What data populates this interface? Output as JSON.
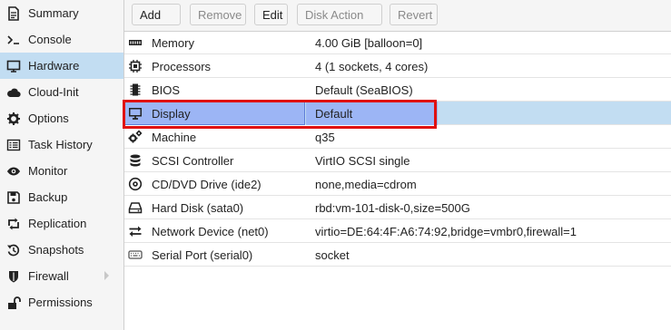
{
  "sidebar": {
    "items": [
      {
        "label": "Summary",
        "icon": "summary-icon"
      },
      {
        "label": "Console",
        "icon": "console-icon"
      },
      {
        "label": "Hardware",
        "icon": "monitor-icon",
        "selected": true
      },
      {
        "label": "Cloud-Init",
        "icon": "cloud-icon"
      },
      {
        "label": "Options",
        "icon": "gear-icon"
      },
      {
        "label": "Task History",
        "icon": "list-icon"
      },
      {
        "label": "Monitor",
        "icon": "eye-icon"
      },
      {
        "label": "Backup",
        "icon": "floppy-icon"
      },
      {
        "label": "Replication",
        "icon": "retweet-icon"
      },
      {
        "label": "Snapshots",
        "icon": "history-icon"
      },
      {
        "label": "Firewall",
        "icon": "shield-icon",
        "has_submenu": true
      },
      {
        "label": "Permissions",
        "icon": "unlock-icon"
      }
    ]
  },
  "toolbar": {
    "add_label": "Add",
    "remove_label": "Remove",
    "edit_label": "Edit",
    "disk_action_label": "Disk Action",
    "revert_label": "Revert"
  },
  "hardware": {
    "rows": [
      {
        "name": "Memory",
        "value": "4.00 GiB [balloon=0]",
        "icon": "memory-icon"
      },
      {
        "name": "Processors",
        "value": "4 (1 sockets, 4 cores)",
        "icon": "cpu-icon"
      },
      {
        "name": "BIOS",
        "value": "Default (SeaBIOS)",
        "icon": "microchip-icon"
      },
      {
        "name": "Display",
        "value": "Default",
        "icon": "desktop-icon",
        "selected": true
      },
      {
        "name": "Machine",
        "value": "q35",
        "icon": "cogs-icon"
      },
      {
        "name": "SCSI Controller",
        "value": "VirtIO SCSI single",
        "icon": "database-icon"
      },
      {
        "name": "CD/DVD Drive (ide2)",
        "value": "none,media=cdrom",
        "icon": "cdrom-icon"
      },
      {
        "name": "Hard Disk (sata0)",
        "value": "rbd:vm-101-disk-0,size=500G",
        "icon": "hdd-icon"
      },
      {
        "name": "Network Device (net0)",
        "value": "virtio=DE:64:4F:A6:74:92,bridge=vmbr0,firewall=1",
        "icon": "exchange-icon"
      },
      {
        "name": "Serial Port (serial0)",
        "value": "socket",
        "icon": "keyboard-icon"
      }
    ]
  },
  "colors": {
    "selection": "#c2ddf2",
    "highlight": "#9cb5f5",
    "annotation_box": "#e01010"
  }
}
